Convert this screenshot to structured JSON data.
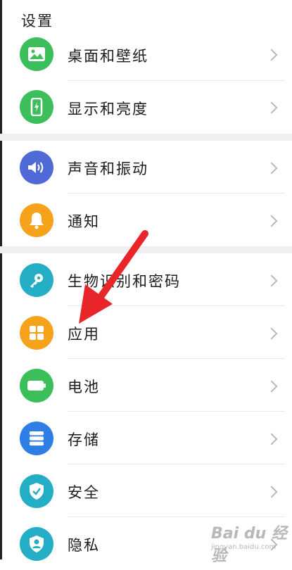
{
  "header": {
    "title": "设置"
  },
  "groups": [
    {
      "items": [
        {
          "label": "桌面和壁纸",
          "icon": "picture-icon",
          "color": "#3cbf5a"
        },
        {
          "label": "显示和亮度",
          "icon": "phone-display-icon",
          "color": "#3cbf5a"
        }
      ]
    },
    {
      "items": [
        {
          "label": "声音和振动",
          "icon": "speaker-icon",
          "color": "#4f6ad6"
        },
        {
          "label": "通知",
          "icon": "bell-icon",
          "color": "#f6a21b"
        }
      ]
    },
    {
      "items": [
        {
          "label": "生物识别和密码",
          "icon": "key-icon",
          "color": "#24aec6"
        },
        {
          "label": "应用",
          "icon": "apps-grid-icon",
          "color": "#f6a21b"
        },
        {
          "label": "电池",
          "icon": "battery-icon",
          "color": "#3cbf5a"
        },
        {
          "label": "存储",
          "icon": "storage-icon",
          "color": "#2f7ee6"
        },
        {
          "label": "安全",
          "icon": "shield-check-icon",
          "color": "#24aec6"
        },
        {
          "label": "隐私",
          "icon": "privacy-icon",
          "color": "#24aec6"
        }
      ]
    }
  ],
  "annotation": {
    "arrow_color": "#e8262a"
  },
  "watermark": {
    "brand": "Bai du 经验",
    "url": "jingyan.baidu.com"
  }
}
